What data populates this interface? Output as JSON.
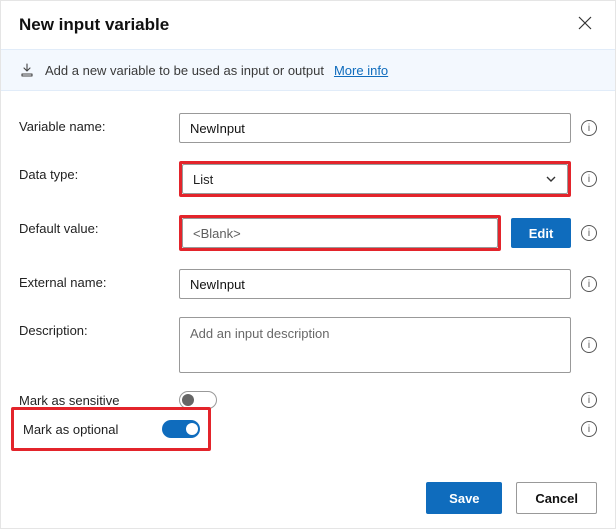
{
  "header": {
    "title": "New input variable"
  },
  "info_bar": {
    "text": "Add a new variable to be used as input or output",
    "link": "More info"
  },
  "labels": {
    "variable_name": "Variable name:",
    "data_type": "Data type:",
    "default_value": "Default value:",
    "external_name": "External name:",
    "description": "Description:",
    "mark_sensitive": "Mark as sensitive",
    "mark_optional": "Mark as optional"
  },
  "fields": {
    "variable_name": "NewInput",
    "data_type": "List",
    "default_value": "<Blank>",
    "external_name": "NewInput",
    "description_ph": "Add an input description",
    "edit_label": "Edit"
  },
  "toggles": {
    "sensitive": false,
    "optional": true
  },
  "footer": {
    "save": "Save",
    "cancel": "Cancel"
  }
}
